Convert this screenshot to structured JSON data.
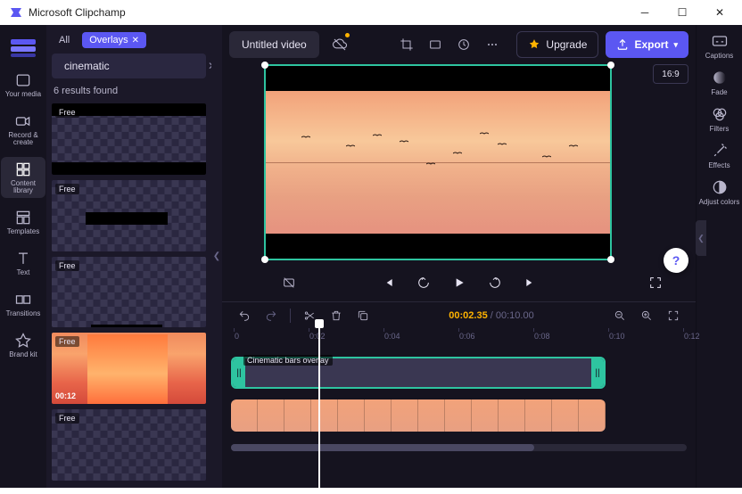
{
  "window": {
    "title": "Microsoft Clipchamp"
  },
  "leftnav": {
    "items": [
      {
        "label": "Your media"
      },
      {
        "label": "Record & create"
      },
      {
        "label": "Content library"
      },
      {
        "label": "Templates"
      },
      {
        "label": "Text"
      },
      {
        "label": "Transitions"
      },
      {
        "label": "Brand kit"
      }
    ]
  },
  "panel": {
    "tab_all": "All",
    "tab_active": "Overlays",
    "search_value": "cinematic",
    "results": "6 results found",
    "free_label": "Free",
    "card_duration": "00:12"
  },
  "project": {
    "title": "Untitled video"
  },
  "topbar": {
    "upgrade": "Upgrade",
    "export": "Export",
    "aspect": "16:9"
  },
  "player": {
    "current": "00:02.35",
    "sep": " / ",
    "total": "00:10.00"
  },
  "ruler": {
    "ticks": [
      "0",
      "0:02",
      "0:04",
      "0:06",
      "0:08",
      "0:10",
      "0:12"
    ]
  },
  "timeline": {
    "overlay_label": "Cinematic bars overlay"
  },
  "rightnav": {
    "items": [
      {
        "label": "Captions"
      },
      {
        "label": "Fade"
      },
      {
        "label": "Filters"
      },
      {
        "label": "Effects"
      },
      {
        "label": "Adjust colors"
      }
    ]
  }
}
